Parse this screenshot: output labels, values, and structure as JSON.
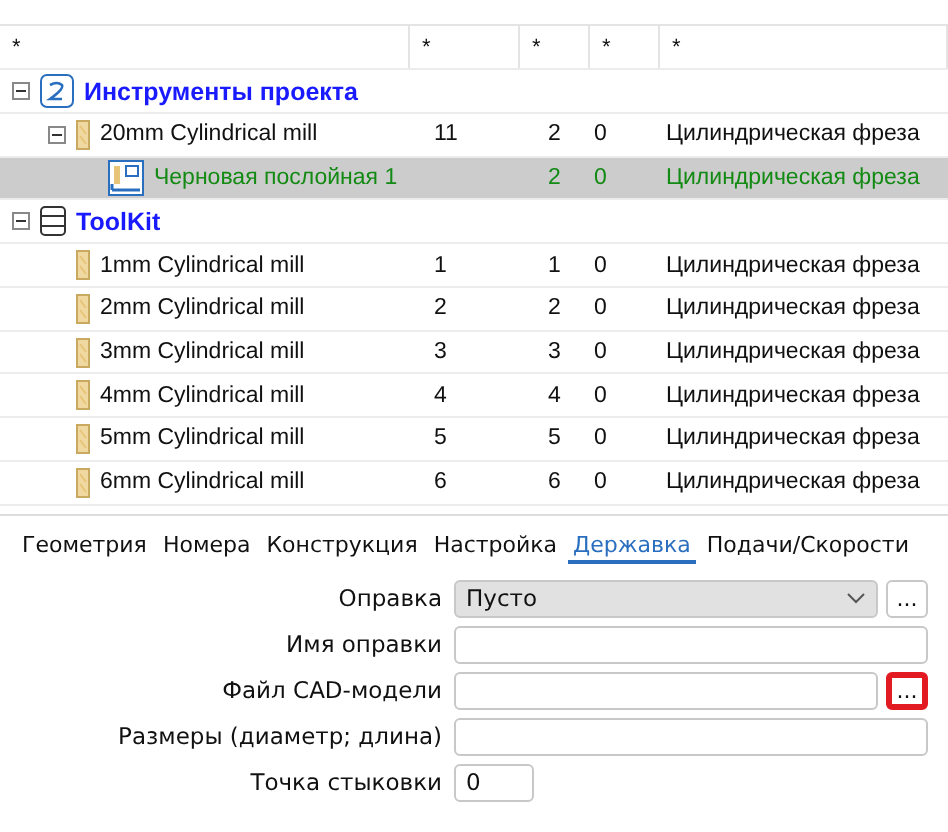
{
  "filter_row": [
    "*",
    "*",
    "*",
    "*",
    "*"
  ],
  "groups": [
    {
      "name": "Инструменты проекта",
      "kind": "project",
      "expanded": true,
      "children": [
        {
          "name": "20mm Cylindrical mill",
          "kind": "tool",
          "id": "11",
          "column_3": "2",
          "column_4": "0",
          "type": "Цилиндрическая фреза",
          "selected": false,
          "expanded": true,
          "children": [
            {
              "name": "Черновая послойная 1",
              "kind": "operation",
              "column_3": "2",
              "column_4": "0",
              "type": "Цилиндрическая фреза",
              "selected": true
            }
          ]
        }
      ]
    },
    {
      "name": "ToolKit",
      "kind": "toolkit",
      "expanded": true,
      "children": [
        {
          "name": "1mm Cylindrical mill",
          "kind": "tool",
          "id": "1",
          "column_3": "1",
          "column_4": "0",
          "type": "Цилиндрическая фреза",
          "selected": false
        },
        {
          "name": "2mm Cylindrical mill",
          "kind": "tool",
          "id": "2",
          "column_3": "2",
          "column_4": "0",
          "type": "Цилиндрическая фреза",
          "selected": false
        },
        {
          "name": "3mm Cylindrical mill",
          "kind": "tool",
          "id": "3",
          "column_3": "3",
          "column_4": "0",
          "type": "Цилиндрическая фреза",
          "selected": false
        },
        {
          "name": "4mm Cylindrical mill",
          "kind": "tool",
          "id": "4",
          "column_3": "4",
          "column_4": "0",
          "type": "Цилиндрическая фреза",
          "selected": false
        },
        {
          "name": "5mm Cylindrical mill",
          "kind": "tool",
          "id": "5",
          "column_3": "5",
          "column_4": "0",
          "type": "Цилиндрическая фреза",
          "selected": false
        },
        {
          "name": "6mm Cylindrical mill",
          "kind": "tool",
          "id": "6",
          "column_3": "6",
          "column_4": "0",
          "type": "Цилиндрическая фреза",
          "selected": false
        }
      ]
    }
  ],
  "tabs": [
    {
      "label": "Геометрия",
      "selected": false
    },
    {
      "label": "Номера",
      "selected": false
    },
    {
      "label": "Конструкция",
      "selected": false
    },
    {
      "label": "Настройка",
      "selected": false
    },
    {
      "label": "Державка",
      "selected": true
    },
    {
      "label": "Подачи/Скорости",
      "selected": false
    }
  ],
  "form": [
    {
      "label": "Оправка",
      "kind": "select",
      "value": "Пусто",
      "button": "...",
      "highlighted": false
    },
    {
      "label": "Имя оправки",
      "kind": "text"
    },
    {
      "label": "Файл CAD-модели",
      "kind": "text",
      "button": "...",
      "highlighted": true
    },
    {
      "label": "Размеры (диаметр; длина)",
      "kind": "text"
    },
    {
      "label": "Точка стыковки",
      "kind": "short",
      "value": "0"
    }
  ]
}
